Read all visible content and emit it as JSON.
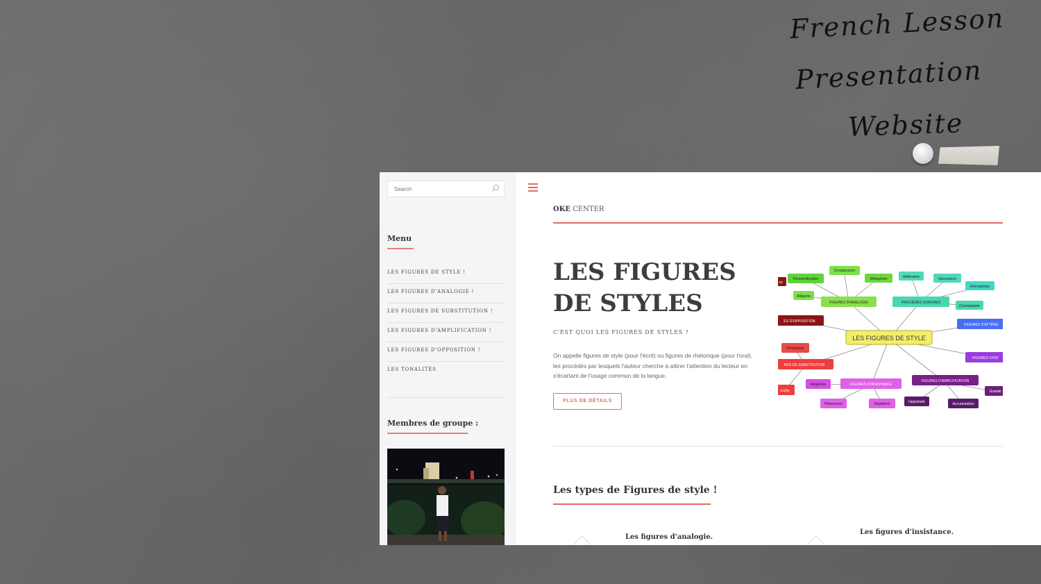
{
  "handwriting": {
    "line1": "French Lesson",
    "line2": "Presentation",
    "line3": "Website"
  },
  "sidebar": {
    "search_placeholder": "Search",
    "menu_title": "Menu",
    "menu_items": [
      "LES FIGURES DE STYLE !",
      "LES FIGURES D'ANALOGIE !",
      "LES FIGURES DE SUBSTITUTION !",
      "LES FIGURES D'AMPLIFICATION !",
      "LES FIGURES D'OPPOSITION !",
      "LES TONALITÉS"
    ],
    "members_title": "Membres de groupe :"
  },
  "header": {
    "brand_bold": "OKE",
    "brand_rest": " CENTER"
  },
  "hero": {
    "title": "LES FIGURES DE STYLES",
    "subtitle": "C'EST QUOI LES FIGURES DE STYLES ?",
    "text": "On appelle figures de style (pour l'écrit) ou figures de rhétorique (pour l'oral), les procédés par lesquels l'auteur cherche à attirer l'attention du lecteur en s'écartant de l'usage commun de la langue.",
    "button": "PLUS DE DÉTAILS"
  },
  "mindmap": {
    "center": "LES FIGURES DE STYLE",
    "nodes": [
      "Personnification",
      "Comparaison",
      "Métaphore",
      "Allitération",
      "Assonance",
      "Homophone",
      "Allégorie",
      "FIGURES D'ANALOGIE",
      "PROCÉDÉS SONORES",
      "Onomatopée",
      "ES D'OPPOSITION",
      "FIGURES D'ATTÉNU",
      "Périphrase",
      "RES DE SUBSTITUTION",
      "FIGURES SYNT",
      "Anaphore",
      "FIGURES D'INSISTANCE",
      "FIGURES D'AMPLIFICATION",
      "Gradati",
      "Pléonasme",
      "Répétition",
      "Hyperbole",
      "Accumulation",
      "ncylie",
      "xe"
    ]
  },
  "section": {
    "title": "Les types de Figures de style !",
    "card1": "Les figures d'analogie.",
    "card2": "Les figures d'insistance."
  },
  "colors": {
    "accent": "#e46a60",
    "board": "#676767"
  }
}
